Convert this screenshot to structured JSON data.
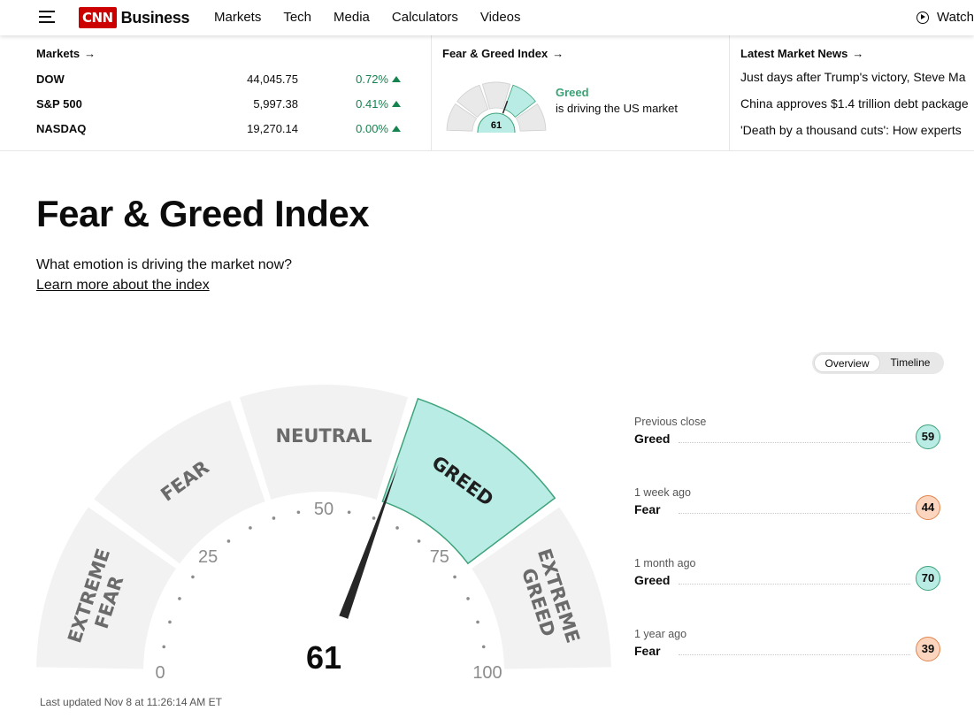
{
  "nav": {
    "brand_logo": "CNN",
    "brand_name": "Business",
    "links": [
      "Markets",
      "Tech",
      "Media",
      "Calculators",
      "Videos"
    ],
    "watch_label": "Watch"
  },
  "markets": {
    "title": "Markets",
    "rows": [
      {
        "name": "DOW",
        "value": "44,045.75",
        "change": "0.72%"
      },
      {
        "name": "S&P 500",
        "value": "5,997.38",
        "change": "0.41%"
      },
      {
        "name": "NASDAQ",
        "value": "19,270.14",
        "change": "0.00%"
      }
    ],
    "up_color": "#16834f"
  },
  "fg_widget": {
    "title": "Fear & Greed Index",
    "value": "61",
    "rating": "Greed",
    "description": "is driving the US market"
  },
  "news": {
    "title": "Latest Market News",
    "items": [
      "Just days after Trump's victory, Steve Ma",
      "China approves $1.4 trillion debt package",
      "'Death by a thousand cuts': How experts"
    ]
  },
  "page": {
    "title": "Fear & Greed Index",
    "subtitle": "What emotion is driving the market now?",
    "learn_link": "Learn more about the index"
  },
  "toggle": {
    "options": [
      "Overview",
      "Timeline"
    ],
    "active": "Overview"
  },
  "gauge": {
    "value": 61,
    "value_label": "61",
    "current_zone": "Greed",
    "zones": [
      "EXTREME FEAR",
      "FEAR",
      "NEUTRAL",
      "GREED",
      "EXTREME GREED"
    ],
    "tick_labels": [
      "0",
      "25",
      "50",
      "75",
      "100"
    ],
    "colors": {
      "active": "#b9ece5",
      "active_border": "#3ea37a",
      "zone": "#f2f2f2",
      "needle": "#262626"
    }
  },
  "history": [
    {
      "when": "Previous close",
      "rating": "Greed",
      "value": "59",
      "kind": "greed"
    },
    {
      "when": "1 week ago",
      "rating": "Fear",
      "value": "44",
      "kind": "fear"
    },
    {
      "when": "1 month ago",
      "rating": "Greed",
      "value": "70",
      "kind": "greed"
    },
    {
      "when": "1 year ago",
      "rating": "Fear",
      "value": "39",
      "kind": "fear"
    }
  ],
  "updated": "Last updated Nov 8 at 11:26:14 AM ET"
}
